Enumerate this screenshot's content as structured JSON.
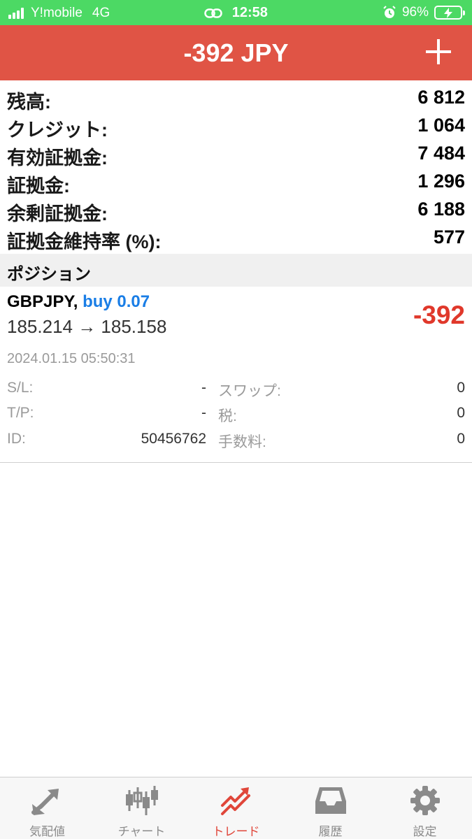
{
  "status_bar": {
    "carrier": "Y!mobile",
    "network": "4G",
    "time": "12:58",
    "battery": "96%"
  },
  "header": {
    "title": "-392 JPY",
    "add_icon": "plus-icon"
  },
  "summary": [
    {
      "label": "残高:",
      "value": "6 812"
    },
    {
      "label": "クレジット:",
      "value": "1 064"
    },
    {
      "label": "有効証拠金:",
      "value": "7 484"
    },
    {
      "label": "証拠金:",
      "value": "1 296"
    },
    {
      "label": "余剰証拠金:",
      "value": "6 188"
    },
    {
      "label": "証拠金維持率 (%):",
      "value": "577"
    }
  ],
  "positions_section": {
    "title": "ポジション"
  },
  "position": {
    "symbol": "GBPJPY,",
    "side": "buy 0.07",
    "prices": "185.214 → 185.158",
    "profit": "-392",
    "time": "2024.01.15 05:50:31",
    "details": {
      "sl_label": "S/L:",
      "sl_value": "-",
      "tp_label": "T/P:",
      "tp_value": "-",
      "id_label": "ID:",
      "id_value": "50456762",
      "swap_label": "スワップ:",
      "swap_value": "0",
      "tax_label": "税:",
      "tax_value": "0",
      "fee_label": "手数料:",
      "fee_value": "0"
    }
  },
  "tabs": [
    {
      "label": "気配値",
      "icon": "quotes-arrows-icon",
      "active": false
    },
    {
      "label": "チャート",
      "icon": "candlestick-chart-icon",
      "active": false
    },
    {
      "label": "トレード",
      "icon": "trade-trend-icon",
      "active": true
    },
    {
      "label": "履歴",
      "icon": "history-tray-icon",
      "active": false
    },
    {
      "label": "設定",
      "icon": "gear-icon",
      "active": false
    }
  ],
  "colors": {
    "status_bar": "#4cd964",
    "header": "#e05445",
    "profit_negative": "#e0382b",
    "buy_side": "#1a7ee6",
    "active_tab": "#e0463a"
  }
}
